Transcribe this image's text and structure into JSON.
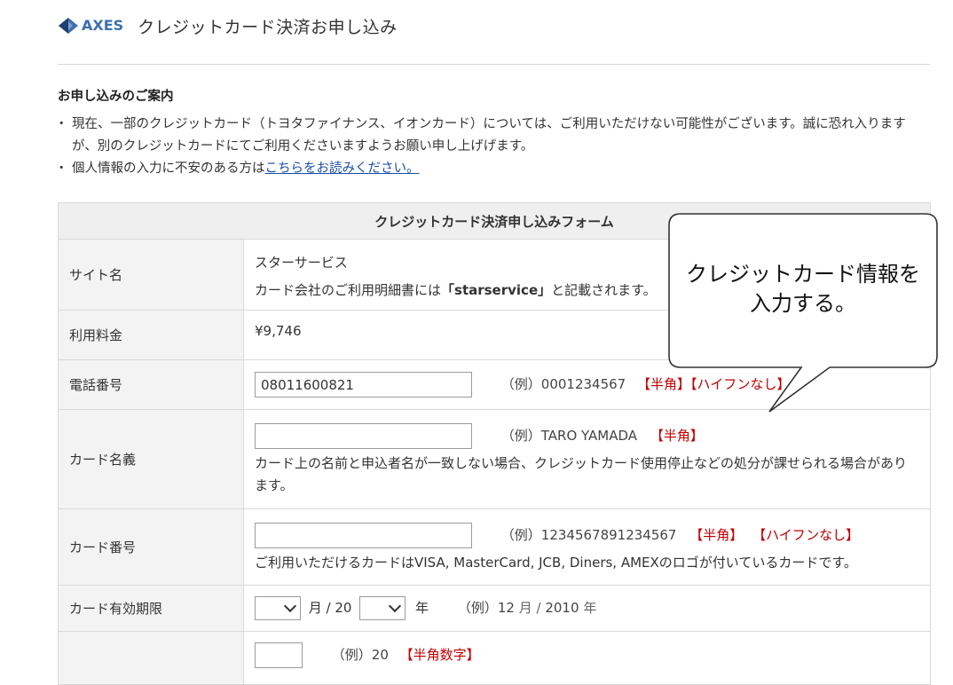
{
  "header": {
    "logo_text": "AXES",
    "title": "クレジットカード決済お申し込み"
  },
  "guide": {
    "title": "お申し込みのご案内",
    "items": [
      {
        "text": "現在、一部のクレジットカード（トヨタファイナンス、イオンカード）については、ご利用いただけない可能性がございます。誠に恐れ入りますが、別のクレジットカードにてご利用くださいますようお願い申し上げげます。"
      },
      {
        "text": "個人情報の入力に不安のある方は",
        "link": "こちらをお読みください。"
      }
    ]
  },
  "form": {
    "heading": "クレジットカード決済申し込みフォーム",
    "site": {
      "label": "サイト名",
      "value": "スターサービス",
      "note_pre": "カード会社のご利用明細書には",
      "note_bold": "「starservice」",
      "note_post": "と記載されます。"
    },
    "fee": {
      "label": "利用料金",
      "value": "¥9,746"
    },
    "phone": {
      "label": "電話番号",
      "value": "08011600821",
      "example": "（例）0001234567",
      "tag1": "【半角】",
      "tag2": "【ハイフンなし】"
    },
    "card_name": {
      "label": "カード名義",
      "value": "",
      "example": "（例）TARO YAMADA",
      "tag1": "【半角】",
      "note": "カード上の名前と申込者名が一致しない場合、クレジットカード使用停止などの処分が課せられる場合があります。"
    },
    "card_number": {
      "label": "カード番号",
      "value": "",
      "example": "（例）1234567891234567",
      "tag1": "【半角】",
      "tag2": "【ハイフンなし】",
      "note": "ご利用いただけるカードはVISA, MasterCard, JCB, Diners, AMEXのロゴが付いているカードです。"
    },
    "expiry": {
      "label": "カード有効期限",
      "month_value": "",
      "month_unit": "月 / 20",
      "year_value": "",
      "year_unit": "年",
      "example_pre": "（例）12",
      "example_month": "月",
      "example_slash": "/",
      "example_year": "2010",
      "example_year_unit": "年"
    },
    "security": {
      "label": "",
      "value": "",
      "example": "（例）20",
      "tag1": "【半角数字】"
    }
  },
  "callout": {
    "text_line1": "クレジットカード情報を",
    "text_line2": "入力する。"
  }
}
